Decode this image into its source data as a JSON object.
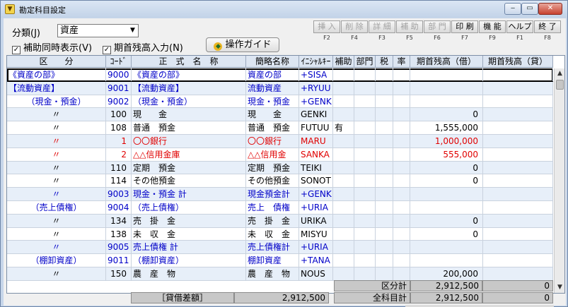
{
  "window": {
    "title": "勘定科目設定",
    "min": "‒",
    "max": "▭",
    "close": "✕"
  },
  "controls": {
    "bunrui_label": "分類(J)",
    "bunrui_value": "資産",
    "hojo_label": "補助同時表示(V)",
    "kishu_label": "期首残高入力(N)",
    "guide_label": "操作ガイド"
  },
  "fkeys": [
    {
      "label": "挿 入",
      "key": "F2",
      "enabled": false
    },
    {
      "label": "削 除",
      "key": "F4",
      "enabled": false
    },
    {
      "label": "詳 細",
      "key": "F3",
      "enabled": false
    },
    {
      "label": "補 助",
      "key": "F5",
      "enabled": false
    },
    {
      "label": "部 門",
      "key": "F6",
      "enabled": false
    },
    {
      "label": "印 刷",
      "key": "F7",
      "enabled": true
    },
    {
      "label": "機 能",
      "key": "F9",
      "enabled": true
    },
    {
      "label": "ヘルプ",
      "key": "F1",
      "enabled": true
    },
    {
      "label": "終 了",
      "key": "F8",
      "enabled": true
    }
  ],
  "columns": [
    "区　　分",
    "ｺｰﾄﾞ",
    "正　式　名　称",
    "簡略名称",
    "ｲﾆｼｬﾙｷｰ",
    "補助",
    "部門",
    "税",
    "率",
    "期首残高（借）",
    "期首残高（貸）"
  ],
  "rows": [
    {
      "kubun": "《資産の部》",
      "code": "9000",
      "name": "《資産の部》",
      "short": "資産の部",
      "init": "+SISA",
      "hojo": "",
      "debit": "",
      "credit": "",
      "color": "blue",
      "kubun_align": "left"
    },
    {
      "kubun": "【流動資産】",
      "code": "9001",
      "name": "【流動資産】",
      "short": "流動資産",
      "init": "+RYUU",
      "hojo": "",
      "debit": "",
      "credit": "",
      "color": "blue",
      "kubun_align": "left"
    },
    {
      "kubun": "（現金・預金）",
      "code": "9002",
      "name": "（現金・預金）",
      "short": "現金・預金",
      "init": "+GENK",
      "hojo": "",
      "debit": "",
      "credit": "",
      "color": "blue",
      "kubun_align": "center"
    },
    {
      "kubun": "〃",
      "code": "100",
      "name": "現　　金",
      "short": "現　　金",
      "init": "GENKI",
      "hojo": "",
      "debit": "0",
      "credit": "",
      "color": "black",
      "kubun_align": "center"
    },
    {
      "kubun": "〃",
      "code": "108",
      "name": "普通　預金",
      "short": "普通　預金",
      "init": "FUTUU",
      "hojo": "有",
      "debit": "1,555,000",
      "credit": "",
      "color": "black",
      "kubun_align": "center"
    },
    {
      "kubun": "〃",
      "code": "1",
      "name": "〇〇銀行",
      "short": "〇〇銀行",
      "init": "MARU",
      "hojo": "",
      "debit": "1,000,000",
      "credit": "",
      "color": "red",
      "kubun_align": "center"
    },
    {
      "kubun": "〃",
      "code": "2",
      "name": "△△信用金庫",
      "short": "△△信用金",
      "init": "SANKA",
      "hojo": "",
      "debit": "555,000",
      "credit": "",
      "color": "red",
      "kubun_align": "center"
    },
    {
      "kubun": "〃",
      "code": "110",
      "name": "定期　預金",
      "short": "定期　預金",
      "init": "TEIKI",
      "hojo": "",
      "debit": "0",
      "credit": "",
      "color": "black",
      "kubun_align": "center"
    },
    {
      "kubun": "〃",
      "code": "114",
      "name": "その他預金",
      "short": "その他預金",
      "init": "SONOT",
      "hojo": "",
      "debit": "0",
      "credit": "",
      "color": "black",
      "kubun_align": "center"
    },
    {
      "kubun": "〃",
      "code": "9003",
      "name": "現金・預金 計",
      "short": "現金預金計",
      "init": "+GENK",
      "hojo": "",
      "debit": "",
      "credit": "",
      "color": "blue",
      "kubun_align": "center"
    },
    {
      "kubun": "（売上債権）",
      "code": "9004",
      "name": "（売上債権）",
      "short": "売上　債権",
      "init": "+URIA",
      "hojo": "",
      "debit": "",
      "credit": "",
      "color": "blue",
      "kubun_align": "center"
    },
    {
      "kubun": "〃",
      "code": "134",
      "name": "売　掛　金",
      "short": "売　掛　金",
      "init": "URIKA",
      "hojo": "",
      "debit": "0",
      "credit": "",
      "color": "black",
      "kubun_align": "center"
    },
    {
      "kubun": "〃",
      "code": "138",
      "name": "未　収　金",
      "short": "未　収　金",
      "init": "MISYU",
      "hojo": "",
      "debit": "0",
      "credit": "",
      "color": "black",
      "kubun_align": "center"
    },
    {
      "kubun": "〃",
      "code": "9005",
      "name": "売上債権 計",
      "short": "売上債権計",
      "init": "+URIA",
      "hojo": "",
      "debit": "",
      "credit": "",
      "color": "blue",
      "kubun_align": "center"
    },
    {
      "kubun": "（棚卸資産）",
      "code": "9011",
      "name": "（棚卸資産）",
      "short": "棚卸資産",
      "init": "+TANA",
      "hojo": "",
      "debit": "",
      "credit": "",
      "color": "blue",
      "kubun_align": "center"
    },
    {
      "kubun": "〃",
      "code": "150",
      "name": "農　産　物",
      "short": "農　産　物",
      "init": "NOUS",
      "hojo": "",
      "debit": "200,000",
      "credit": "",
      "color": "black",
      "kubun_align": "center"
    }
  ],
  "totals": {
    "kubun_label": "区分計",
    "kubun_debit": "2,912,500",
    "kubun_credit": "0",
    "taishaku_label": "［貸借差額］",
    "taishaku_value": "2,912,500",
    "zen_label": "全科目計",
    "zen_debit": "2,912,500",
    "zen_credit": "0"
  },
  "colors": {
    "blue": "#0000c8",
    "red": "#e00000",
    "header": "#dde6f2",
    "alt_row": "#e7eff9"
  }
}
